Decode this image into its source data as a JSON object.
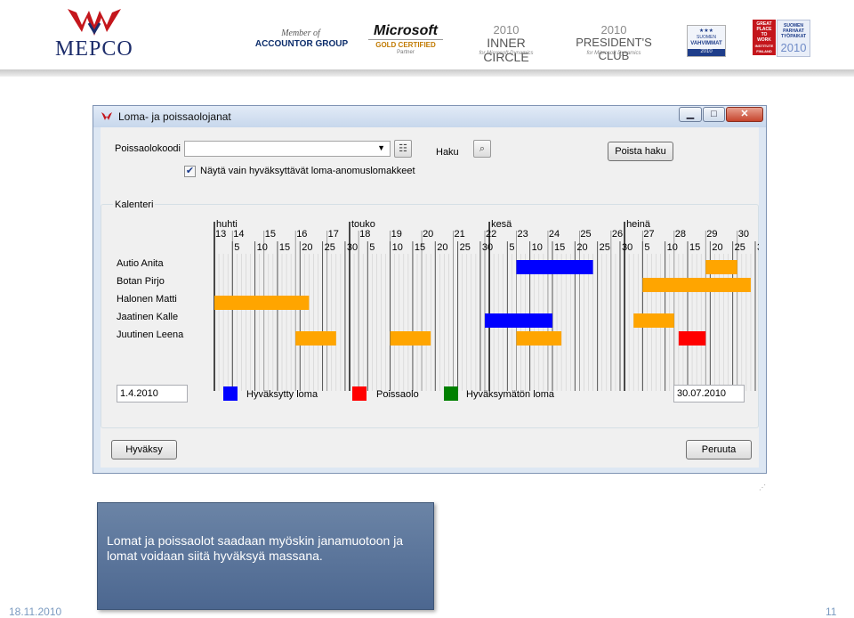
{
  "header": {
    "logo_text": "MEPCO",
    "accountor_small": "Member of",
    "accountor_big": "ACCOUNTOR GROUP",
    "microsoft": "Microsoft",
    "microsoft_cert": "GOLD CERTIFIED",
    "microsoft_partner": "Partner",
    "inner_circle_year": "2010",
    "inner_circle_title": "INNER CIRCLE",
    "inner_circle_sub": "for Microsoft Dynamics",
    "presidents_year": "2010",
    "presidents_title": "PRESIDENT'S CLUB",
    "presidents_sub": "for Microsoft Dynamics",
    "badge1_stars": "★★★",
    "badge1_line1": "SUOMEN",
    "badge1_line2": "VAHVIMMAT",
    "badge1_year": "2010",
    "badge2_lines": [
      "GREAT",
      "PLACE",
      "TO",
      "WORK",
      "INSTITUTE",
      "FINLAND"
    ],
    "badge3_lines": [
      "SUOMEN",
      "PARHAAT",
      "TYÖPAIKAT"
    ],
    "badge3_year": "2010"
  },
  "window": {
    "title": "Loma- ja poissaolojanat",
    "poissaolokoodi_label": "Poissaolokoodi",
    "combo_value": "",
    "haku_label": "Haku",
    "poista_haku": "Poista haku",
    "checkbox_checked": true,
    "checkbox_label": "Näytä vain hyväksyttävät loma-anomuslomakkeet",
    "kalenteri_label": "Kalenteri",
    "start_date": "1.4.2010",
    "end_date": "30.07.2010",
    "hyvaksy": "Hyväksy",
    "peruuta": "Peruuta"
  },
  "legend": [
    {
      "label": "Hyväksytty loma",
      "color": "#0000ff"
    },
    {
      "label": "Poissaolo",
      "color": "#ff0000"
    },
    {
      "label": "Hyväksymätön loma",
      "color": "#008000"
    }
  ],
  "chart_data": {
    "type": "gantt",
    "months": [
      "huhti",
      "touko",
      "kesä",
      "heinä"
    ],
    "week_numbers": [
      "13",
      "14",
      "15",
      "16",
      "17",
      "18",
      "19",
      "20",
      "21",
      "22",
      "23",
      "24",
      "25",
      "26",
      "27",
      "28",
      "29",
      "30"
    ],
    "day_labels": [
      "5",
      "10",
      "15",
      "20",
      "25",
      "30",
      "5",
      "10",
      "15",
      "20",
      "25",
      "30",
      "5",
      "10",
      "15",
      "20",
      "25",
      "30",
      "5",
      "10",
      "15",
      "20",
      "25",
      "30"
    ],
    "people": [
      "Autio Anita",
      "Botan Pirjo",
      "Halonen Matti",
      "Jaatinen Kalle",
      "Juutinen Leena"
    ],
    "bars": [
      {
        "row": 0,
        "start": "2010-06-07",
        "end": "2010-06-24",
        "color": "#0000ff"
      },
      {
        "row": 0,
        "start": "2010-07-19",
        "end": "2010-07-26",
        "color": "#ffa500"
      },
      {
        "row": 1,
        "start": "2010-07-05",
        "end": "2010-07-29",
        "color": "#ffa500"
      },
      {
        "row": 2,
        "start": "2010-04-01",
        "end": "2010-04-22",
        "color": "#ffa500"
      },
      {
        "row": 3,
        "start": "2010-05-31",
        "end": "2010-06-15",
        "color": "#0000ff"
      },
      {
        "row": 3,
        "start": "2010-07-03",
        "end": "2010-07-12",
        "color": "#ffa500"
      },
      {
        "row": 4,
        "start": "2010-04-19",
        "end": "2010-04-28",
        "color": "#ffa500"
      },
      {
        "row": 4,
        "start": "2010-05-10",
        "end": "2010-05-19",
        "color": "#ffa500"
      },
      {
        "row": 4,
        "start": "2010-06-07",
        "end": "2010-06-17",
        "color": "#ffa500"
      },
      {
        "row": 4,
        "start": "2010-07-13",
        "end": "2010-07-19",
        "color": "#ff0000"
      }
    ],
    "date_range": [
      "2010-04-01",
      "2010-07-30"
    ]
  },
  "callout": {
    "text": "Lomat ja poissaolot saadaan myöskin janamuotoon ja lomat voidaan siitä hyväksyä massana."
  },
  "footer": {
    "date": "18.11.2010",
    "page": "11"
  }
}
